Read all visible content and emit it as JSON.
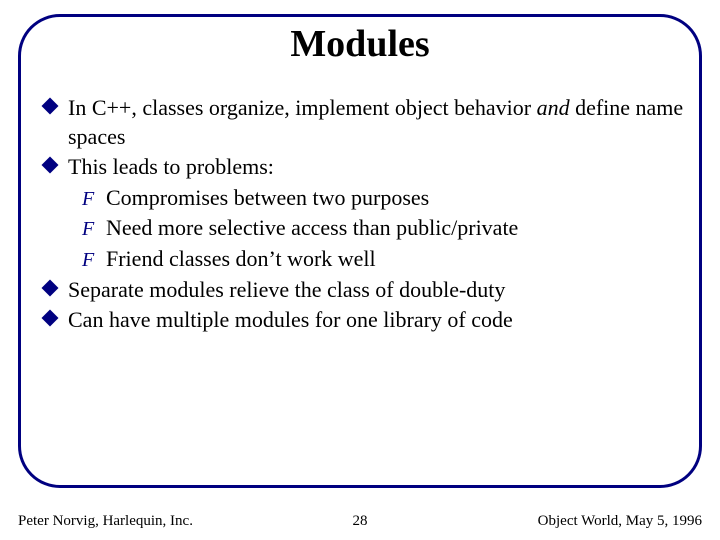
{
  "title": "Modules",
  "bullets": {
    "b1_a": "In C++, classes organize, implement object behavior ",
    "b1_b": "and",
    "b1_c": " define name spaces",
    "b2": "This leads to problems:",
    "b2_1": "Compromises between two purposes",
    "b2_2": "Need more selective access than public/private",
    "b2_3": "Friend classes don’t work well",
    "b3": "Separate modules relieve the class of double-duty",
    "b4": "Can have multiple modules for one library of code"
  },
  "footer": {
    "left": "Peter Norvig, Harlequin, Inc.",
    "center": "28",
    "right": "Object World, May 5, 1996"
  }
}
